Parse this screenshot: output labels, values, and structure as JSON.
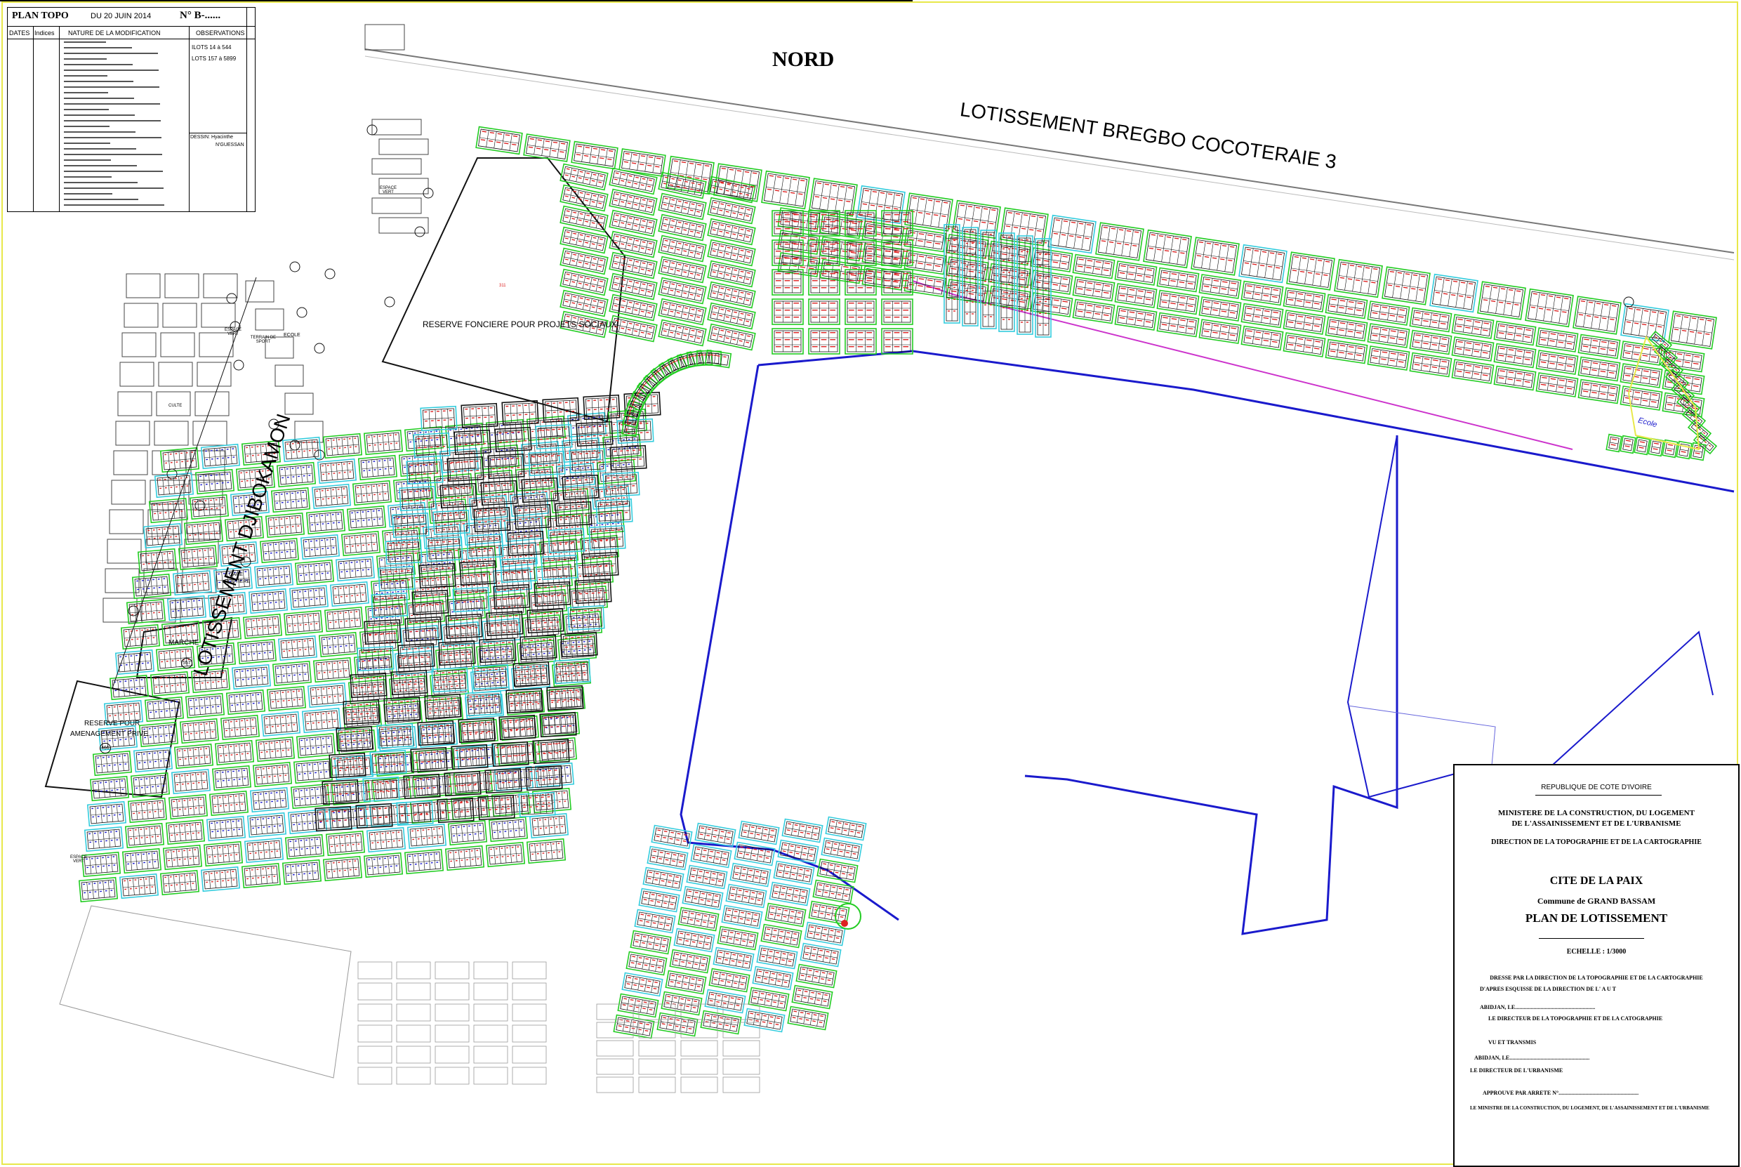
{
  "header": {
    "title": "PLAN TOPO",
    "date": "DU 20 JUIN 2014",
    "number": "N° B-......",
    "col_dates": "DATES",
    "col_indices": "Indices",
    "col_nature": "NATURE DE LA MODIFICATION",
    "col_observations": "OBSERVATIONS",
    "obs_lines": [
      "ILOTS 14 à 544",
      "LOTS 157 à 5899"
    ],
    "dessin": "DESSIN: Hyacinthe",
    "dessin_name": "N'GUESSAN"
  },
  "labels": {
    "north": "NORD",
    "bregbo": "LOTISSEMENT BREGBO COCOTERAIE 3",
    "djibokamon": "LOTISSEMENT DJIBOKAMON",
    "reserve_fonciere": "RESERVE FONCIERE POUR PROJETS SOCIAUX",
    "reserve_amenagement_1": "RESERVE POUR",
    "reserve_amenagement_2": "AMENAGEMENT PRIVE",
    "marche": "MARCHE",
    "gare_1": "GARE",
    "gare_2": "ROUTIERE",
    "ecole": "ECOLE",
    "ecole_small": "Ecole",
    "espace_vert": "ESPACE VERT",
    "terrain_sport": "TERRAIN DE SPORT",
    "culte": "CULTE",
    "lot_466": "466",
    "lot_557": "557",
    "lot_311": "311"
  },
  "title_block": {
    "republic": "REPUBLIQUE DE COTE D'IVOIRE",
    "ministry_1": "MINISTERE DE LA CONSTRUCTION, DU LOGEMENT",
    "ministry_2": "DE L'ASSAINISSEMENT ET DE L'URBANISME",
    "direction": "DIRECTION DE LA TOPOGRAPHIE ET DE LA CARTOGRAPHIE",
    "project": "CITE DE LA PAIX",
    "commune": "Commune de GRAND BASSAM",
    "plan": "PLAN DE LOTISSEMENT",
    "scale": "ECHELLE : 1/3000",
    "dresse": "DRESSE PAR LA DIRECTION DE LA TOPOGRAPHIE ET DE LA CARTOGRAPHIE",
    "esquisse": "D'APRES ESQUISSE DE LA DIRECTION DE L' A U T",
    "abidjan_1": "ABIDJAN, LE.........................................................",
    "directeur_topo": "LE DIRECTEUR DE LA TOPOGRAPHIE ET DE LA CATOGRAPHIE",
    "vu": "VU ET TRANSMIS",
    "abidjan_2": "ABIDJAN, LE.........................................................",
    "directeur_urb": "LE DIRECTEUR DE L'URBANISME",
    "approuve": "APPROUVE PAR ARRETE N°.........................................................",
    "ministre": "LE MINISTRE DE LA CONSTRUCTION, DU LOGEMENT, DE L'ASSAINISSEMENT ET DE L'URBANISME"
  },
  "colors": {
    "green": "#22cc22",
    "cyan": "#33ccdd",
    "red": "#dd2222",
    "blue": "#1a1acc",
    "magenta": "#cc33cc",
    "yellow": "#e8e84a",
    "black": "#111111",
    "grey": "#999999"
  }
}
